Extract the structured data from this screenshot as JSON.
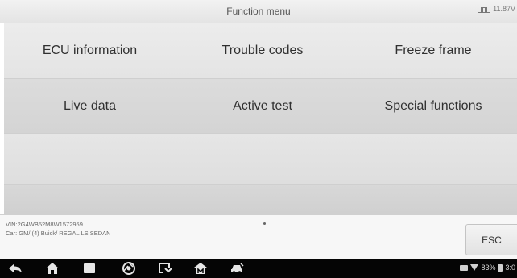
{
  "header": {
    "title": "Function menu",
    "voltage": "11.87V"
  },
  "menu": {
    "rows": [
      [
        "ECU information",
        "Trouble codes",
        "Freeze frame"
      ],
      [
        "Live data",
        "Active test",
        "Special functions"
      ],
      [
        "",
        "",
        ""
      ],
      [
        "",
        "",
        ""
      ]
    ]
  },
  "footer": {
    "vin": "VIN:2G4WB52M8W1572959",
    "car": "Car: GM/ (4) Buick/ REGAL LS SEDAN",
    "esc_label": "ESC"
  },
  "navbar": {
    "icons": [
      "back-icon",
      "home-icon",
      "recent-apps-icon",
      "chrome-icon",
      "screenshot-icon",
      "autel-home-icon",
      "car-icon"
    ],
    "status_text": "83%",
    "time": "3:0"
  },
  "colors": {
    "navbar_bg": "#050505",
    "header_text": "#555555",
    "menu_text": "#303030"
  }
}
